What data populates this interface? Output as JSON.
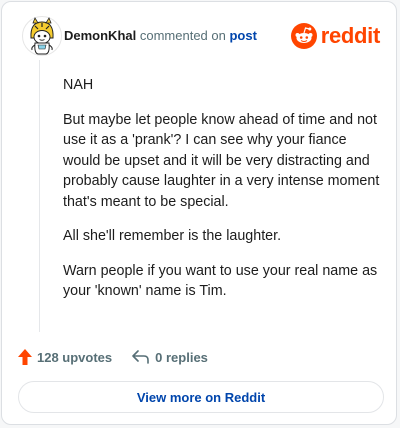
{
  "header": {
    "username": "DemonKhal",
    "action_text": "commented on",
    "post_link": "post",
    "brand": "reddit"
  },
  "comment": {
    "paragraphs": [
      "NAH",
      "But maybe let people know ahead of time and not use it as a 'prank'? I can see why your fiance would be upset and it will be very distracting and probably cause laughter in a very intense moment that's meant to be special.",
      "All she'll remember is the laughter.",
      "Warn people if you want to use your real name as your 'known' name is Tim."
    ]
  },
  "actions": {
    "upvotes": "128 upvotes",
    "replies": "0 replies"
  },
  "footer": {
    "view_more": "View more on Reddit"
  },
  "colors": {
    "brand": "#ff4500",
    "upvote": "#ff4500",
    "link": "#0045ac",
    "muted": "#576f76"
  },
  "icons": [
    "snoo-avatar-icon",
    "reddit-logo-icon",
    "upvote-arrow-icon",
    "reply-icon"
  ]
}
